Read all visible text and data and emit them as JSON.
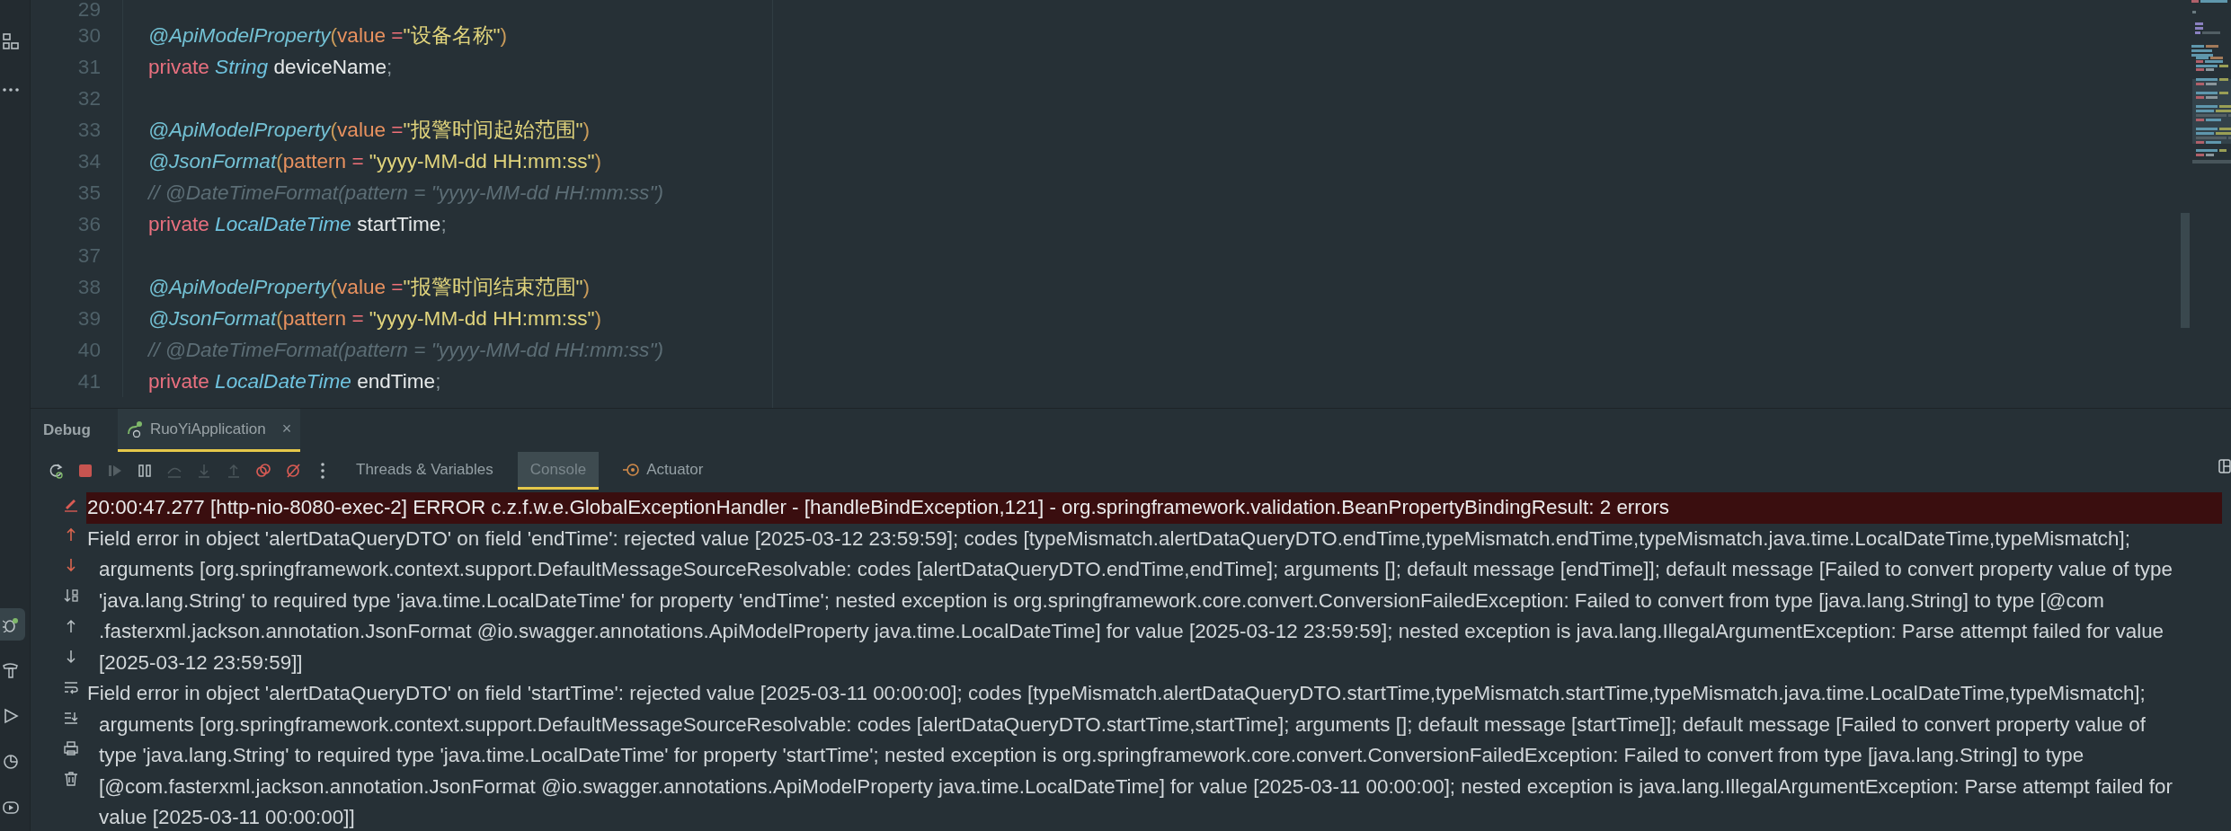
{
  "left_toolbar": {
    "top": [
      {
        "kind": "structure",
        "selected": false
      },
      {
        "kind": "more",
        "selected": false
      }
    ],
    "bottom": [
      {
        "kind": "debug",
        "selected": true
      },
      {
        "kind": "build",
        "selected": false
      },
      {
        "kind": "run",
        "selected": false
      },
      {
        "kind": "profiler",
        "selected": false
      },
      {
        "kind": "services",
        "selected": false
      }
    ]
  },
  "editor": {
    "lines": [
      {
        "number": "29"
      },
      {
        "number": "30",
        "tokens": [
          {
            "kind": "annotation",
            "text": "@ApiModelProperty"
          },
          {
            "kind": "paren",
            "text": "("
          },
          {
            "kind": "attr",
            "text": "value "
          },
          {
            "kind": "op",
            "text": "="
          },
          {
            "kind": "string",
            "text": "\"设备名称\""
          },
          {
            "kind": "paren",
            "text": ")"
          }
        ]
      },
      {
        "number": "31",
        "tokens": [
          {
            "kind": "keyword",
            "text": "private "
          },
          {
            "kind": "type",
            "text": "String "
          },
          {
            "kind": "ident",
            "text": "deviceName"
          },
          {
            "kind": "punct",
            "text": ";"
          }
        ]
      },
      {
        "number": "32"
      },
      {
        "number": "33",
        "tokens": [
          {
            "kind": "annotation",
            "text": "@ApiModelProperty"
          },
          {
            "kind": "paren",
            "text": "("
          },
          {
            "kind": "attr",
            "text": "value "
          },
          {
            "kind": "op",
            "text": "="
          },
          {
            "kind": "string",
            "text": "\"报警时间起始范围\""
          },
          {
            "kind": "paren",
            "text": ")"
          }
        ]
      },
      {
        "number": "34",
        "tokens": [
          {
            "kind": "annotation",
            "text": "@JsonFormat"
          },
          {
            "kind": "paren",
            "text": "("
          },
          {
            "kind": "attr",
            "text": "pattern "
          },
          {
            "kind": "op",
            "text": "= "
          },
          {
            "kind": "string",
            "text": "\"yyyy-MM-dd HH:mm:ss\""
          },
          {
            "kind": "paren",
            "text": ")"
          }
        ]
      },
      {
        "number": "35",
        "tokens": [
          {
            "kind": "comment",
            "text": "// @DateTimeFormat(pattern = \"yyyy-MM-dd HH:mm:ss\")"
          }
        ]
      },
      {
        "number": "36",
        "tokens": [
          {
            "kind": "keyword",
            "text": "private "
          },
          {
            "kind": "type",
            "text": "LocalDateTime "
          },
          {
            "kind": "ident",
            "text": "startTime"
          },
          {
            "kind": "punct",
            "text": ";"
          }
        ]
      },
      {
        "number": "37"
      },
      {
        "number": "38",
        "tokens": [
          {
            "kind": "annotation",
            "text": "@ApiModelProperty"
          },
          {
            "kind": "paren",
            "text": "("
          },
          {
            "kind": "attr",
            "text": "value "
          },
          {
            "kind": "op",
            "text": "="
          },
          {
            "kind": "string",
            "text": "\"报警时间结束范围\""
          },
          {
            "kind": "paren",
            "text": ")"
          }
        ]
      },
      {
        "number": "39",
        "tokens": [
          {
            "kind": "annotation",
            "text": "@JsonFormat"
          },
          {
            "kind": "paren",
            "text": "("
          },
          {
            "kind": "attr",
            "text": "pattern "
          },
          {
            "kind": "op",
            "text": "= "
          },
          {
            "kind": "string",
            "text": "\"yyyy-MM-dd HH:mm:ss\""
          },
          {
            "kind": "paren",
            "text": ")"
          }
        ]
      },
      {
        "number": "40",
        "tokens": [
          {
            "kind": "comment",
            "text": "// @DateTimeFormat(pattern = \"yyyy-MM-dd HH:mm:ss\")"
          }
        ]
      },
      {
        "number": "41",
        "tokens": [
          {
            "kind": "keyword",
            "text": "private "
          },
          {
            "kind": "type",
            "text": "LocalDateTime "
          },
          {
            "kind": "ident",
            "text": "endTime"
          },
          {
            "kind": "punct",
            "text": ";"
          }
        ]
      }
    ]
  },
  "debug": {
    "title": "Debug",
    "tabs": [
      {
        "label": "RuoYiApplication",
        "selected": true,
        "close": "×"
      }
    ],
    "actions": [
      {
        "kind": "rerun",
        "disabled": false
      },
      {
        "kind": "stop",
        "disabled": false
      },
      {
        "kind": "resume",
        "disabled": true
      },
      {
        "kind": "pause",
        "disabled": false
      },
      {
        "kind": "step-over",
        "disabled": true
      },
      {
        "kind": "step-into",
        "disabled": true
      },
      {
        "kind": "step-out",
        "disabled": true
      },
      {
        "kind": "breakpoints",
        "disabled": false
      },
      {
        "kind": "mute",
        "disabled": false
      },
      {
        "kind": "more",
        "disabled": false
      }
    ],
    "views": [
      {
        "label": "Threads & Variables",
        "selected": false
      },
      {
        "label": "Console",
        "selected": true
      },
      {
        "label": "Actuator",
        "selected": false,
        "kind": "actuator"
      }
    ],
    "console_actions": [
      {
        "kind": "edit"
      },
      {
        "kind": "up-red"
      },
      {
        "kind": "down-red"
      },
      {
        "kind": "sort"
      },
      {
        "kind": "up"
      },
      {
        "kind": "down"
      },
      {
        "kind": "wrap"
      },
      {
        "kind": "scroll-end"
      },
      {
        "kind": "print"
      },
      {
        "kind": "trash"
      }
    ],
    "console": [
      {
        "kind": "error",
        "lines": [
          "20:00:47.277 [http-nio-8080-exec-2] ERROR c.z.f.w.e.GlobalExceptionHandler - [handleBindException,121] - org.springframework.validation.BeanPropertyBindingResult: 2 errors"
        ]
      },
      {
        "kind": "output",
        "lines": [
          "Field error in object 'alertDataQueryDTO' on field 'endTime': rejected value [2025-03-12 23:59:59]; codes [typeMismatch.alertDataQueryDTO.endTime,typeMismatch.endTime,typeMismatch.java.time.LocalDateTime,typeMismatch];",
          "arguments [org.springframework.context.support.DefaultMessageSourceResolvable: codes [alertDataQueryDTO.endTime,endTime]; arguments []; default message [endTime]]; default message [Failed to convert property value of type",
          "'java.lang.String' to required type 'java.time.LocalDateTime' for property 'endTime'; nested exception is org.springframework.core.convert.ConversionFailedException: Failed to convert from type [java.lang.String] to type [@com",
          ".fasterxml.jackson.annotation.JsonFormat @io.swagger.annotations.ApiModelProperty java.time.LocalDateTime] for value [2025-03-12 23:59:59]; nested exception is java.lang.IllegalArgumentException: Parse attempt failed for value",
          "[2025-03-12 23:59:59]]"
        ]
      },
      {
        "kind": "output",
        "lines": [
          "Field error in object 'alertDataQueryDTO' on field 'startTime': rejected value [2025-03-11 00:00:00]; codes [typeMismatch.alertDataQueryDTO.startTime,typeMismatch.startTime,typeMismatch.java.time.LocalDateTime,typeMismatch];",
          "arguments [org.springframework.context.support.DefaultMessageSourceResolvable: codes [alertDataQueryDTO.startTime,startTime]; arguments []; default message [startTime]]; default message [Failed to convert property value of",
          "type 'java.lang.String' to required type 'java.time.LocalDateTime' for property 'startTime'; nested exception is org.springframework.core.convert.ConversionFailedException: Failed to convert from type [java.lang.String] to type",
          "[@com.fasterxml.jackson.annotation.JsonFormat @io.swagger.annotations.ApiModelProperty java.time.LocalDateTime] for value [2025-03-11 00:00:00]; nested exception is java.lang.IllegalArgumentException: Parse attempt failed for",
          "value [2025-03-11 00:00:00]]"
        ]
      }
    ]
  }
}
